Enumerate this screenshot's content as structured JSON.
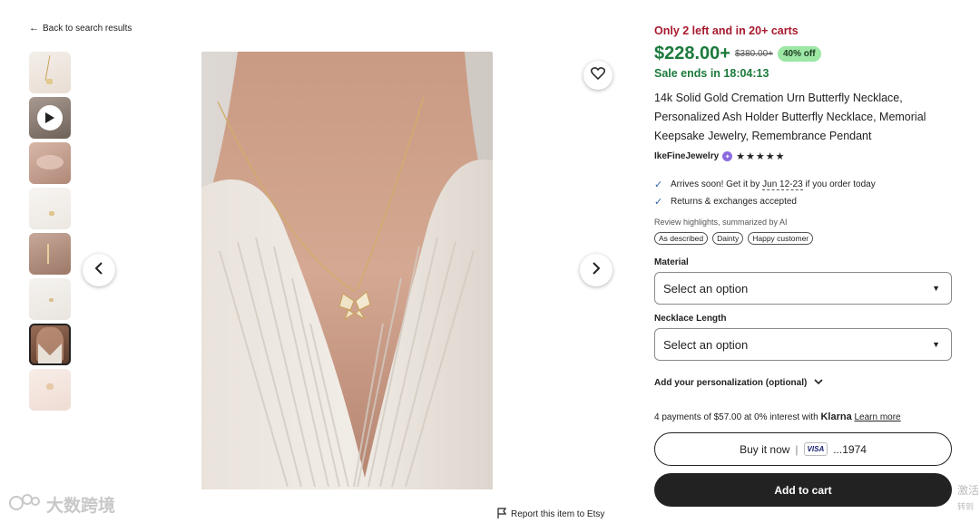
{
  "back_link": "Back to search results",
  "report_link": "Report this item to Etsy",
  "listing": {
    "stock_notice": "Only 2 left and in 20+ carts",
    "price": "$228.00+",
    "original_price": "$380.00+",
    "discount_badge": "40% off",
    "sale_ends": "Sale ends in 18:04:13",
    "title": "14k Solid Gold Cremation Urn Butterfly Necklace, Personalized Ash Holder Butterfly Necklace, Memorial Keepsake Jewelry, Remembrance Pendant",
    "shop_name": "IkeFineJewelry",
    "rating_stars": "★★★★★",
    "delivery_prefix": "Arrives soon! Get it by",
    "delivery_date": "Jun 12-23",
    "delivery_suffix": "if you order today",
    "returns": "Returns & exchanges accepted",
    "review_highlights_title": "Review highlights, summarized by AI",
    "review_chips": [
      "As described",
      "Dainty",
      "Happy customer"
    ]
  },
  "options": {
    "material_label": "Material",
    "material_placeholder": "Select an option",
    "length_label": "Necklace Length",
    "length_placeholder": "Select an option",
    "personalization_label": "Add your personalization (optional)"
  },
  "payment": {
    "installments_text": "4 payments of $57.00 at 0% interest with",
    "klarna_brand": "Klarna",
    "learn_more": "Learn more",
    "buy_now_label": "Buy it now",
    "card_brand": "VISA",
    "card_last4": "...1974",
    "add_to_cart_label": "Add to cart"
  },
  "overlays": {
    "watermark_text": "大数跨境",
    "side_text_line1": "激活",
    "side_text_line2": "转到"
  },
  "colors": {
    "stock_red": "#a61a2e",
    "price_green": "#1c7a3c",
    "discount_bg": "#9be7a3",
    "button_dark": "#222222"
  }
}
